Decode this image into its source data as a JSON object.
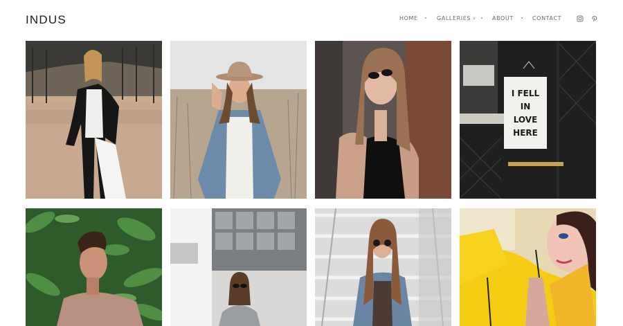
{
  "site": {
    "title": "INDUS"
  },
  "nav": {
    "items": [
      {
        "label": "HOME"
      },
      {
        "label": "GALLERIES",
        "has_dropdown": true
      },
      {
        "label": "ABOUT"
      },
      {
        "label": "CONTACT"
      }
    ],
    "social": [
      {
        "icon": "instagram-icon"
      },
      {
        "icon": "pinterest-icon"
      }
    ]
  },
  "gallery": {
    "sign_lines": [
      "I FELL",
      "IN",
      "LOVE",
      "HERE"
    ]
  },
  "colors": {
    "text": "#1b1b1b",
    "nav_text": "#6a6a6a",
    "background": "#ffffff"
  }
}
